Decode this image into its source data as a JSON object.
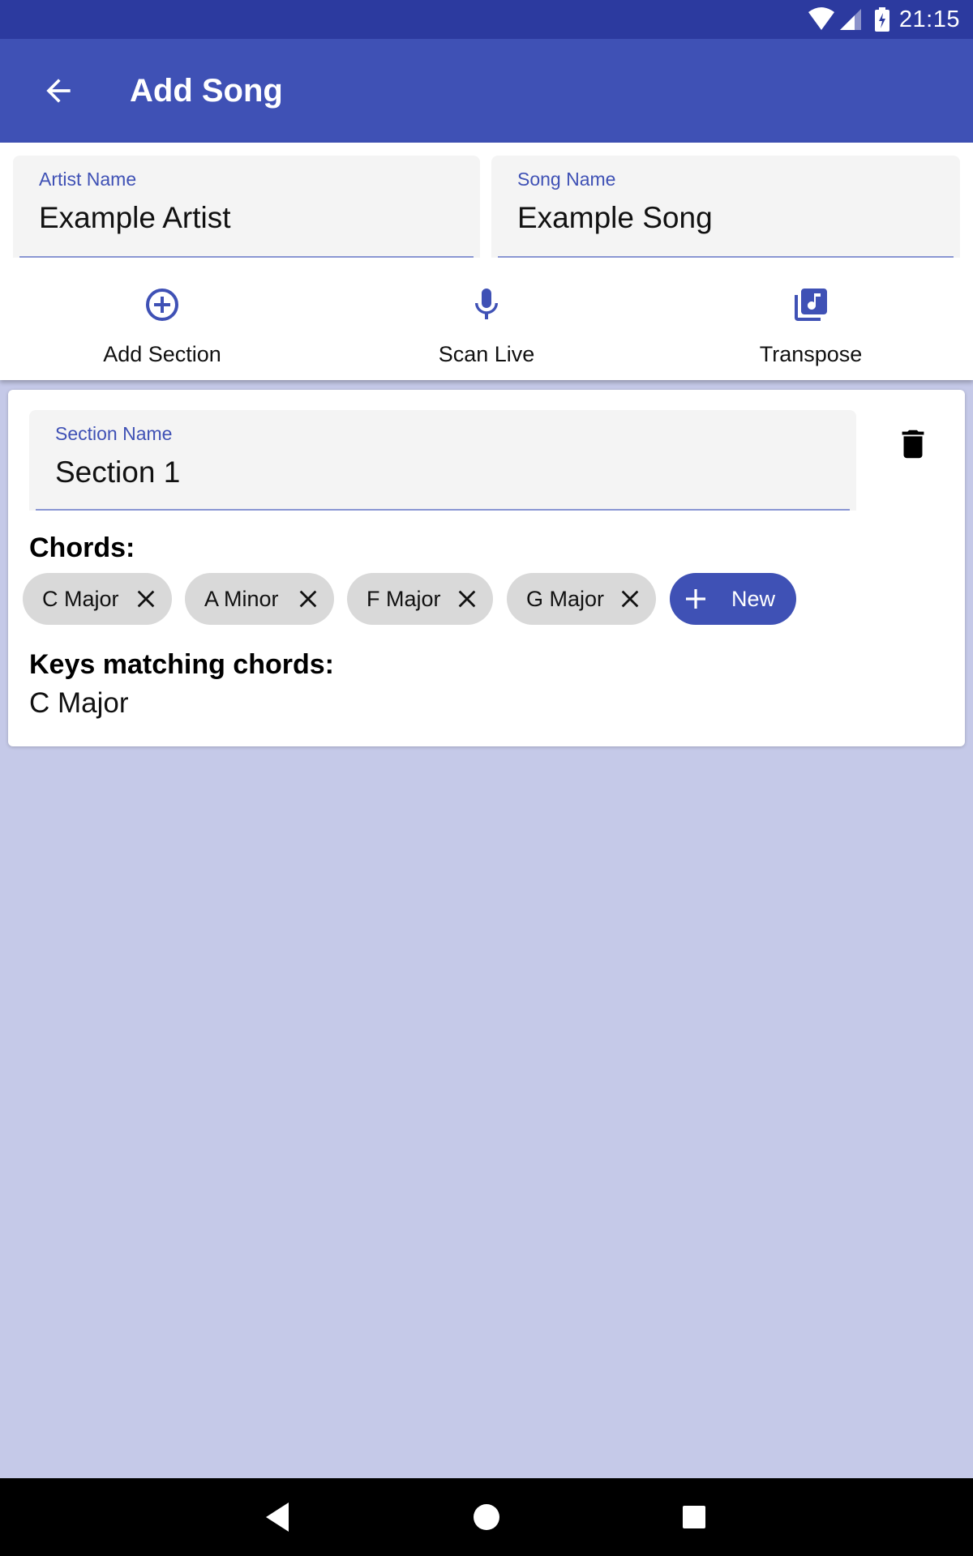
{
  "status_bar": {
    "time": "21:15",
    "icons": [
      "wifi-icon",
      "signal-icon",
      "battery-charging-icon"
    ]
  },
  "app_bar": {
    "title": "Add Song",
    "back_icon": "arrow-left-icon"
  },
  "form": {
    "artist": {
      "label": "Artist Name",
      "value": "Example Artist"
    },
    "song": {
      "label": "Song Name",
      "value": "Example Song"
    }
  },
  "actions": [
    {
      "label": "Add Section",
      "icon": "add-circle-icon"
    },
    {
      "label": "Scan Live",
      "icon": "microphone-icon"
    },
    {
      "label": "Transpose",
      "icon": "music-library-icon"
    }
  ],
  "section": {
    "name_label": "Section Name",
    "name_value": "Section 1",
    "chords_heading": "Chords:",
    "chords": [
      "C Major",
      "A Minor",
      "F Major",
      "G Major"
    ],
    "new_chip_label": "New",
    "keys_heading": "Keys matching chords:",
    "keys_value": "C Major"
  },
  "colors": {
    "primary": "#3f51b5",
    "primary_dark": "#2c3a9f",
    "background": "#c5c9e8",
    "chip": "#d9d9d9"
  }
}
